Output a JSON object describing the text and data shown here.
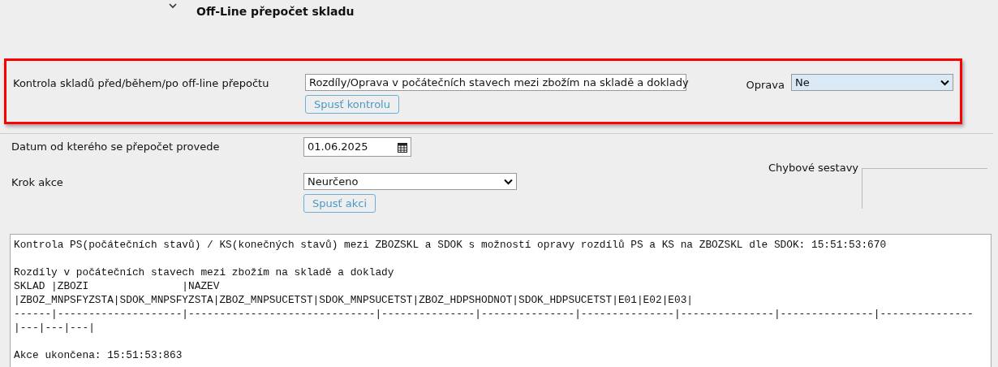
{
  "section": {
    "title": "Off-Line přepočet skladu",
    "expanded": true
  },
  "check_panel": {
    "label": "Kontrola skladů před/během/po off-line přepočtu",
    "select_value": "Rozdíly/Oprava v počátečních stavech mezi zbožím na skladě a doklady",
    "button": "Spusť kontrolu",
    "fix_label": "Oprava",
    "fix_value": "Ne"
  },
  "date_row": {
    "label": "Datum od kterého se přepočet provede",
    "value": "01.06.2025"
  },
  "step_row": {
    "label": "Krok akce",
    "select_value": "Neurčeno",
    "button": "Spusť akci"
  },
  "error_reports": {
    "legend": "Chybové sestavy"
  },
  "log_blocks": [
    [
      "Kontrola PS(počátečních stavů) / KS(konečných stavů) mezi ZBOZSKL a SDOK s možností opravy rozdílů PS a KS na ZBOZSKL dle SDOK: 15:51:53:670"
    ],
    [
      "Rozdíly v počátečních stavech mezi zbožím na skladě a doklady",
      "SKLAD |ZBOZI               |NAZEV",
      "|ZBOZ_MNPSFYZSTA|SDOK_MNPSFYZSTA|ZBOZ_MNPSUCETST|SDOK_MNPSUCETST|ZBOZ_HDPSHODNOT|SDOK_HDPSUCETST|E01|E02|E03|",
      "------|--------------------|------------------------------|---------------|---------------|---------------|---------------|---------------|---------------",
      "|---|---|---|"
    ],
    [
      "Akce ukončena: 15:51:53:863"
    ]
  ]
}
